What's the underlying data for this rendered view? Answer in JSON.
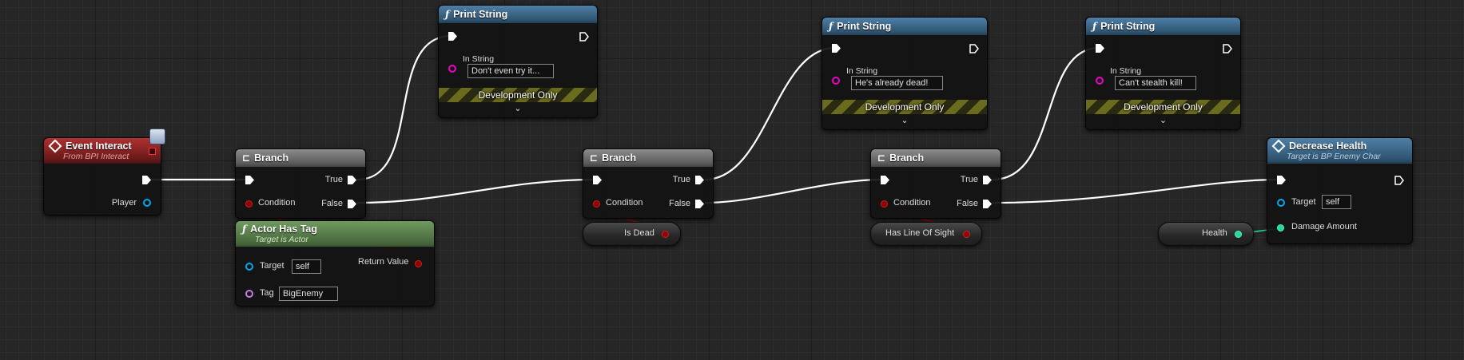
{
  "colors": {
    "exec_wire": "#ffffff",
    "bool_pin": "#920101",
    "object_pin": "#00a8f2",
    "float_pin": "#1ed79c",
    "string_pin": "#f000c8",
    "name_pin": "#c87be8"
  },
  "event_interact": {
    "title": "Event Interact",
    "subtitle": "From BPI Interact",
    "player_label": "Player",
    "icon": "event-diamond-icon"
  },
  "branch1": {
    "title": "Branch",
    "condition": "Condition",
    "true_label": "True",
    "false_label": "False"
  },
  "branch2": {
    "title": "Branch",
    "condition": "Condition",
    "true_label": "True",
    "false_label": "False"
  },
  "branch3": {
    "title": "Branch",
    "condition": "Condition",
    "true_label": "True",
    "false_label": "False"
  },
  "print1": {
    "title": "Print String",
    "in_string_label": "In String",
    "in_string_value": "Don't even try it...",
    "dev_only": "Development Only"
  },
  "print2": {
    "title": "Print String",
    "in_string_label": "In String",
    "in_string_value": "He's already dead!",
    "dev_only": "Development Only"
  },
  "print3": {
    "title": "Print String",
    "in_string_label": "In String",
    "in_string_value": "Can't stealth kill!",
    "dev_only": "Development Only"
  },
  "actor_has_tag": {
    "title": "Actor Has Tag",
    "subtitle": "Target is Actor",
    "target_label": "Target",
    "target_value": "self",
    "tag_label": "Tag",
    "tag_value": "BigEnemy",
    "return_label": "Return Value"
  },
  "is_dead": {
    "label": "Is Dead"
  },
  "has_los": {
    "label": "Has Line Of Sight"
  },
  "health": {
    "label": "Health"
  },
  "decrease_health": {
    "title": "Decrease Health",
    "subtitle": "Target is BP Enemy Char",
    "target_label": "Target",
    "target_value": "self",
    "damage_label": "Damage Amount"
  }
}
